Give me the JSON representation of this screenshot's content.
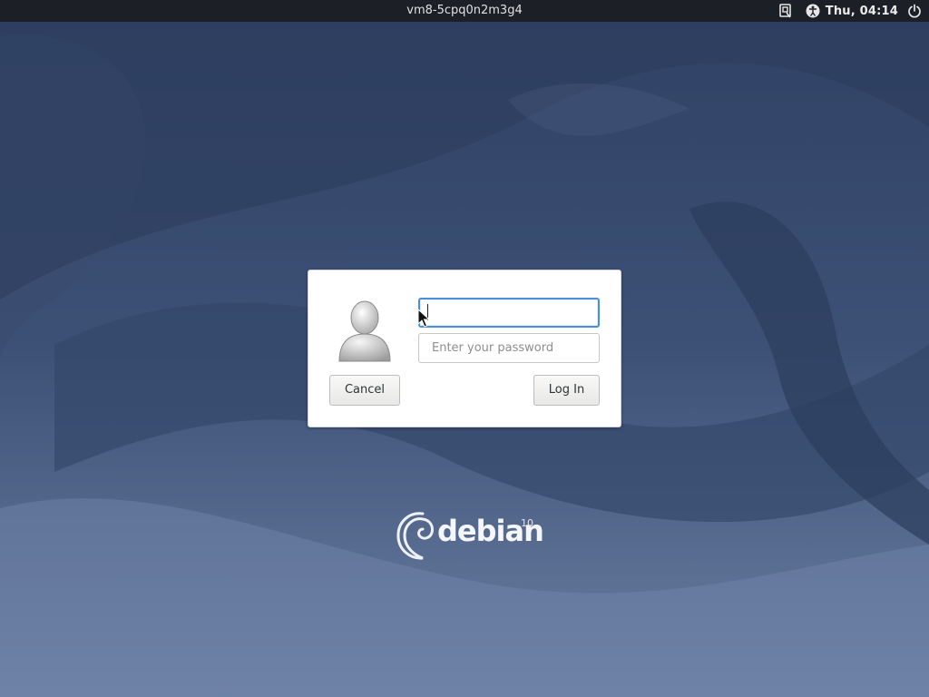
{
  "topbar": {
    "hostname": "vm8-5cpq0n2m3g4",
    "clock": "Thu, 04:14",
    "icons": [
      "keyboard-layout-icon",
      "accessibility-icon",
      "power-icon"
    ]
  },
  "login": {
    "username_value": "",
    "password_placeholder": "Enter your password",
    "cancel_label": "Cancel",
    "login_label": "Log In"
  },
  "branding": {
    "word": "debian",
    "version": "10"
  },
  "colors": {
    "panel": "#1d1f27",
    "focus_ring": "#4a90d9",
    "wallpaper_base": "#3b4e6e"
  }
}
